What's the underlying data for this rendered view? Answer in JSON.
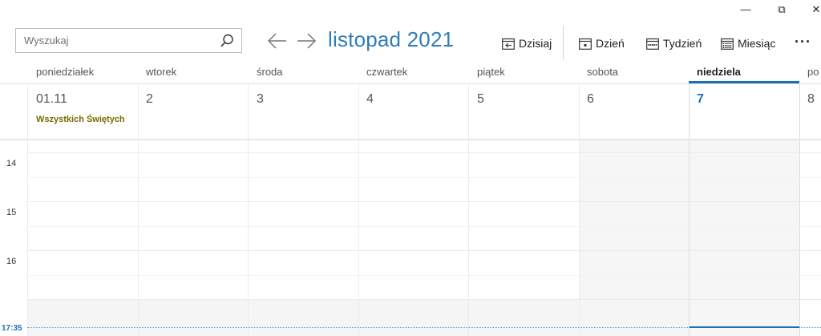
{
  "window": {
    "minimize": "—",
    "restore": "⧉",
    "close": "✕"
  },
  "search": {
    "placeholder": "Wyszukaj"
  },
  "nav": {
    "month_title": "listopad 2021"
  },
  "toolbar": {
    "today_label": "Dzisiaj",
    "day_label": "Dzień",
    "week_label": "Tydzień",
    "month_label": "Miesiąc",
    "more": "···"
  },
  "days": [
    {
      "name": "poniedziałek",
      "number": "01.11",
      "event": "Wszystkich Świętych"
    },
    {
      "name": "wtorek",
      "number": "2"
    },
    {
      "name": "środa",
      "number": "3"
    },
    {
      "name": "czwartek",
      "number": "4"
    },
    {
      "name": "piątek",
      "number": "5"
    },
    {
      "name": "sobota",
      "number": "6"
    },
    {
      "name": "niedziela",
      "number": "7",
      "today": true
    },
    {
      "name": "po",
      "number": "8"
    }
  ],
  "hours": [
    "14",
    "15",
    "16"
  ],
  "current_time": "17:35",
  "colors": {
    "accent": "#1b6fb5",
    "holiday": "#7a6a00",
    "title": "#2e7cb8"
  }
}
